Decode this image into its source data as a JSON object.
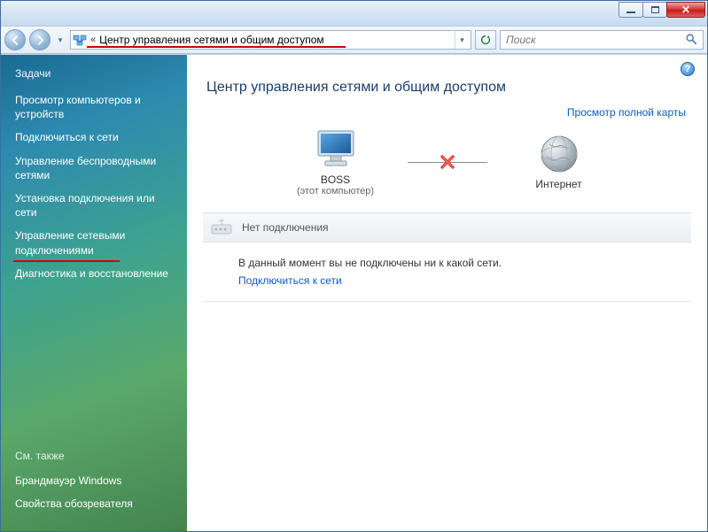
{
  "titlebar": {},
  "nav": {
    "address_text": "Центр управления сетями и общим доступом",
    "search_placeholder": "Поиск"
  },
  "sidebar": {
    "heading": "Задачи",
    "links": [
      "Просмотр компьютеров и устройств",
      "Подключиться к сети",
      "Управление беспроводными сетями",
      "Установка подключения или сети",
      "Управление сетевыми подключениями",
      "Диагностика и восстановление"
    ],
    "footer_heading": "См. также",
    "footer_links": [
      "Брандмауэр Windows",
      "Свойства обозревателя"
    ]
  },
  "main": {
    "title": "Центр управления сетями и общим доступом",
    "full_map_link": "Просмотр полной карты",
    "node_computer_name": "BOSS",
    "node_computer_sub": "(этот компьютер)",
    "node_internet": "Интернет",
    "no_conn_header": "Нет подключения",
    "no_conn_message": "В данный момент вы не подключены ни к какой сети.",
    "connect_link": "Подключиться к сети"
  },
  "help_tooltip": "?"
}
